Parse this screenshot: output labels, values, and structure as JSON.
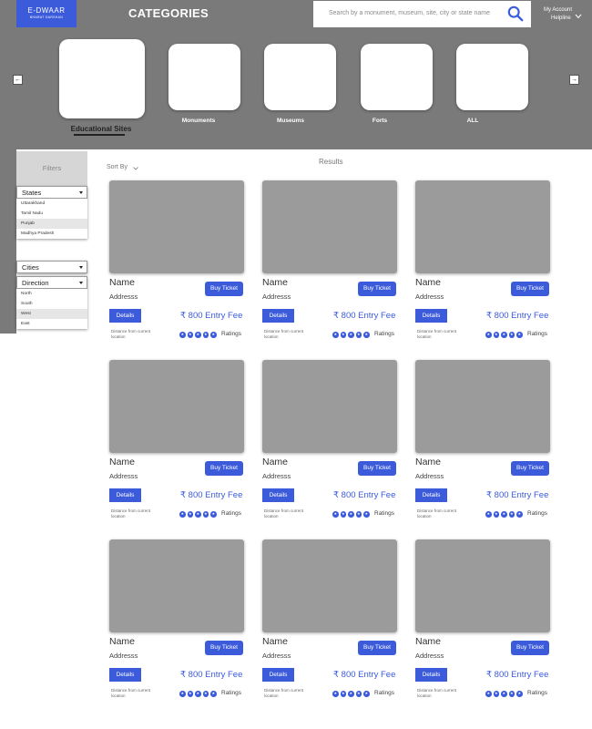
{
  "header": {
    "logo_title": "E-DWAAR",
    "logo_sub": "BHARAT DARSHAN",
    "heading": "CATEGORIES",
    "search_placeholder": "Search by a monument, museum, site, city or state name",
    "account_line1": "My Account",
    "account_line2": "Helpline"
  },
  "categories": [
    {
      "label": "Educational Sites",
      "selected": true
    },
    {
      "label": "Monuments",
      "selected": false
    },
    {
      "label": "Museums",
      "selected": false
    },
    {
      "label": "Forts",
      "selected": false
    },
    {
      "label": "ALL",
      "selected": false
    }
  ],
  "nav": {
    "prev": "←",
    "next": "→"
  },
  "filters": {
    "heading": "Filters",
    "states": {
      "label": "States",
      "options": [
        "Uttarakhand",
        "Tamil Nadu",
        "Punjab",
        "Madhya Pradesh"
      ],
      "selected": "Punjab"
    },
    "cities": {
      "label": "Cities"
    },
    "direction": {
      "label": "Direction",
      "options": [
        "North",
        "South",
        "West",
        "East"
      ],
      "selected": "West"
    }
  },
  "results": {
    "title": "Results",
    "sort_label": "Sort By",
    "card": {
      "name": "Name",
      "address": "Addresss",
      "buy_label": "Buy Ticket",
      "details_label": "Details",
      "fee": "₹ 800 Entry Fee",
      "distance": "Distance from current location",
      "ratings_label": "Ratings",
      "star_marks": [
        "★",
        "★",
        "★",
        "★",
        "★"
      ]
    },
    "card_count": 9
  },
  "colors": {
    "accent": "#3b5bdb",
    "band": "#7a7a7a",
    "card_image": "#9b9b9b"
  }
}
